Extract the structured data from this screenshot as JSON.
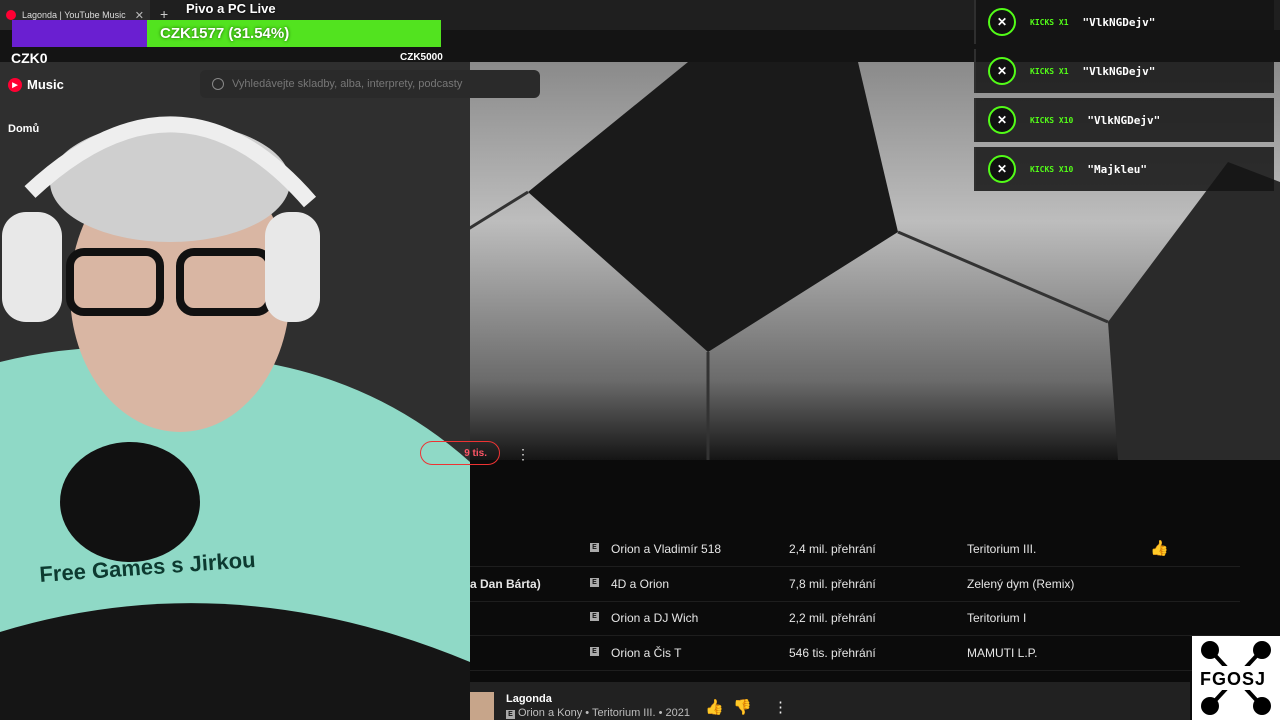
{
  "browser": {
    "tab_title": "Lagonda | YouTube Music",
    "tab_close": "✕",
    "new_tab": "+"
  },
  "overlay": {
    "stream_title": "Pivo a PC Live",
    "goal_text": "CZK1577 (31.54%)",
    "goal_progress": 0.3154,
    "goal_start": "CZK0",
    "goal_target": "CZK5000",
    "bar_fill_color": "#52e31f",
    "bar_bg_color": "#6a1fd1"
  },
  "ytmusic": {
    "logo_text": "Music",
    "nav_home": "Domů",
    "search_placeholder": "Vyhledávejte skladby, alba, interprety, podcasty",
    "likes_pill": "9 tis."
  },
  "alerts": [
    {
      "kicks": "KICKS X1",
      "user": "\"VlkNGDejv\""
    },
    {
      "kicks": "KICKS X1",
      "user": "\"VlkNGDejv\""
    },
    {
      "kicks": "KICKS X10",
      "user": "\"VlkNGDejv\""
    },
    {
      "kicks": "KICKS X10",
      "user": "\"Majkleu\""
    }
  ],
  "songs": [
    {
      "title": "",
      "artist": "Orion a Vladimír 518",
      "plays": "2,4 mil. přehrání",
      "album": "Teritorium III."
    },
    {
      "title": "a Dan Bárta)",
      "artist": "4D a Orion",
      "plays": "7,8 mil. přehrání",
      "album": "Zelený dym (Remix)"
    },
    {
      "title": "",
      "artist": "Orion a DJ Wich",
      "plays": "2,2 mil. přehrání",
      "album": "Teritorium I"
    },
    {
      "title": "",
      "artist": "Orion a Čis T",
      "plays": "546 tis. přehrání",
      "album": "MAMUTI L.P."
    }
  ],
  "player": {
    "title": "Lagonda",
    "subtitle": "Orion a Kony • Teritorium III. • 2021"
  },
  "logo": {
    "text": "FGOSJ"
  },
  "icons": {
    "explicit": "E",
    "like": "👍",
    "dislike": "👎",
    "more": "⋮",
    "kick_badge": "✕"
  },
  "colors": {
    "kick_green": "#53fc18",
    "yt_red": "#ff0033"
  }
}
